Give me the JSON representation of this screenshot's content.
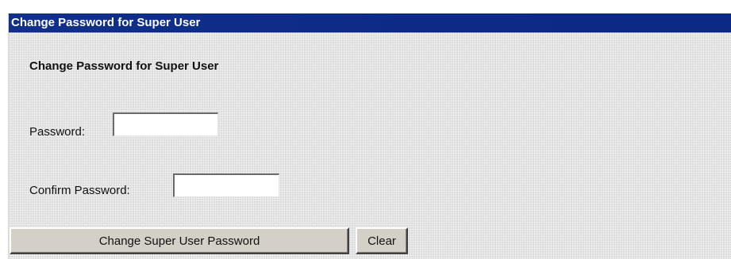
{
  "title_bar": {
    "text": "Change Password for Super User"
  },
  "form": {
    "heading": "Change Password for Super User",
    "password": {
      "label": "Password:",
      "value": ""
    },
    "confirm_password": {
      "label": "Confirm Password:",
      "value": ""
    },
    "submit_label": "Change Super User Password",
    "clear_label": "Clear"
  },
  "colors": {
    "title_bar_bg": "#0c2a86",
    "title_bar_text": "#ffffff",
    "panel_bg": "#ececec",
    "button_face": "#d4d0c8"
  }
}
